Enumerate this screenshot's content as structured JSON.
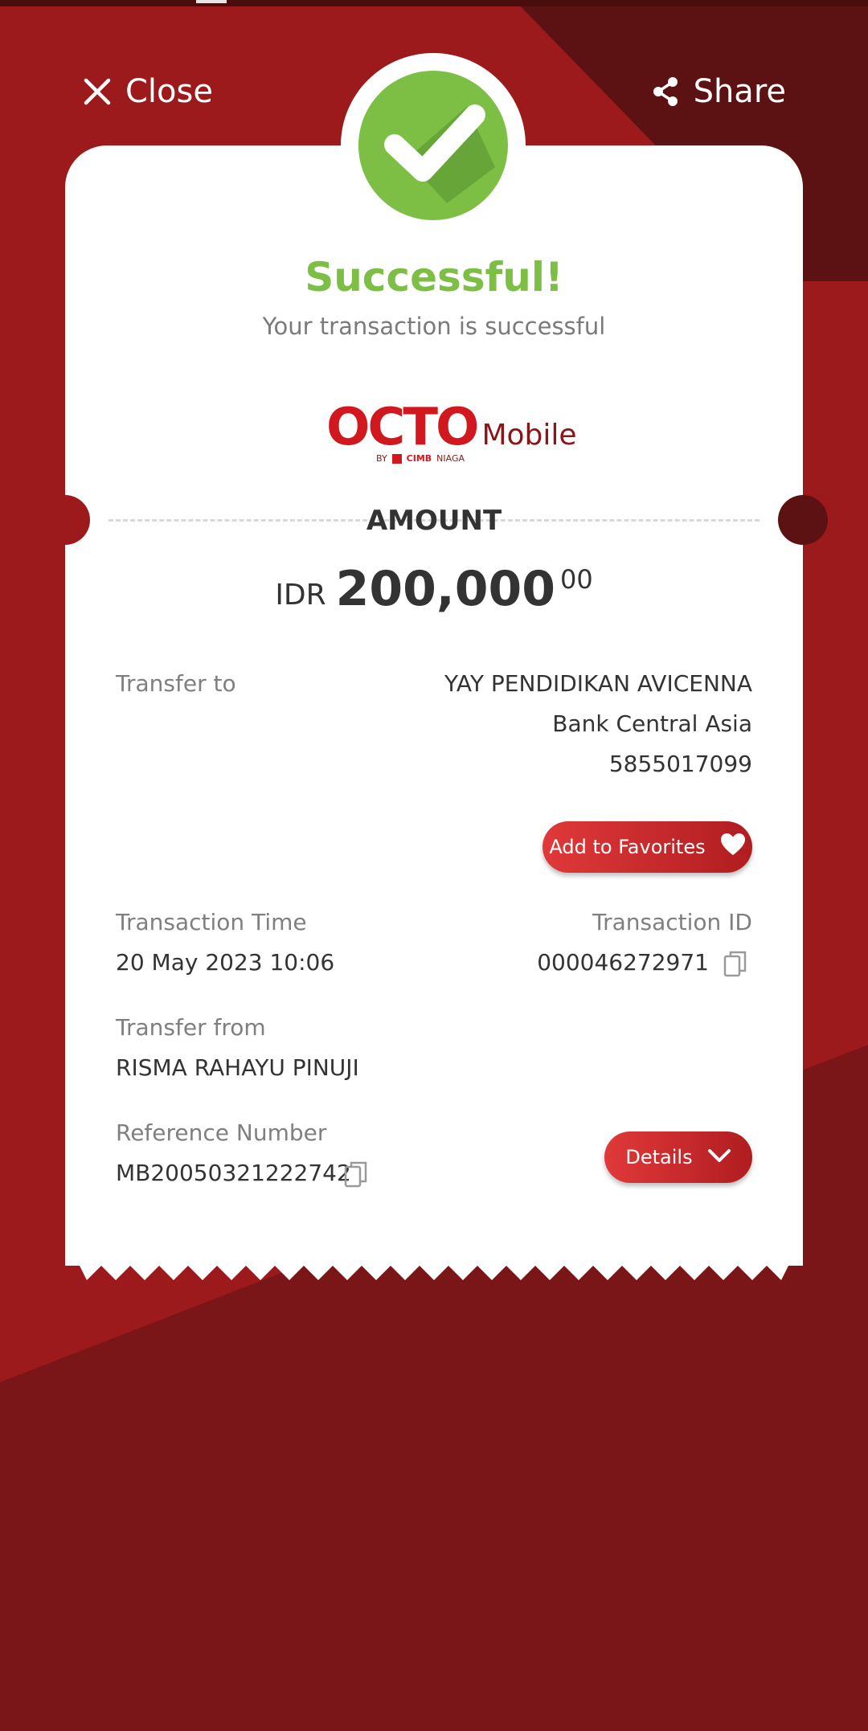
{
  "header": {
    "close_label": "Close",
    "share_label": "Share"
  },
  "status": {
    "title": "Successful!",
    "subtitle": "Your transaction is successful"
  },
  "logo": {
    "brand": "OCTO",
    "product": "Mobile",
    "by": "BY",
    "bank_bold": "CIMB",
    "bank": "NIAGA"
  },
  "amount": {
    "label": "AMOUNT",
    "currency": "IDR",
    "value": "200,000",
    "decimals": "00"
  },
  "transfer_to": {
    "label": "Transfer to",
    "name": "YAY PENDIDIKAN AVICENNA",
    "bank": "Bank Central Asia",
    "account": "5855017099"
  },
  "favorites_button": "Add to Favorites",
  "transaction_time": {
    "label": "Transaction Time",
    "value": "20 May 2023 10:06"
  },
  "transaction_id": {
    "label": "Transaction ID",
    "value": "000046272971"
  },
  "transfer_from": {
    "label": "Transfer from",
    "value": "RISMA RAHAYU PINUJI"
  },
  "reference": {
    "label": "Reference Number",
    "value": "MB20050321222742"
  },
  "details_button": "Details",
  "colors": {
    "primary_red": "#9c1a1c",
    "success_green": "#7cbf44",
    "button_red": "#d83435"
  }
}
